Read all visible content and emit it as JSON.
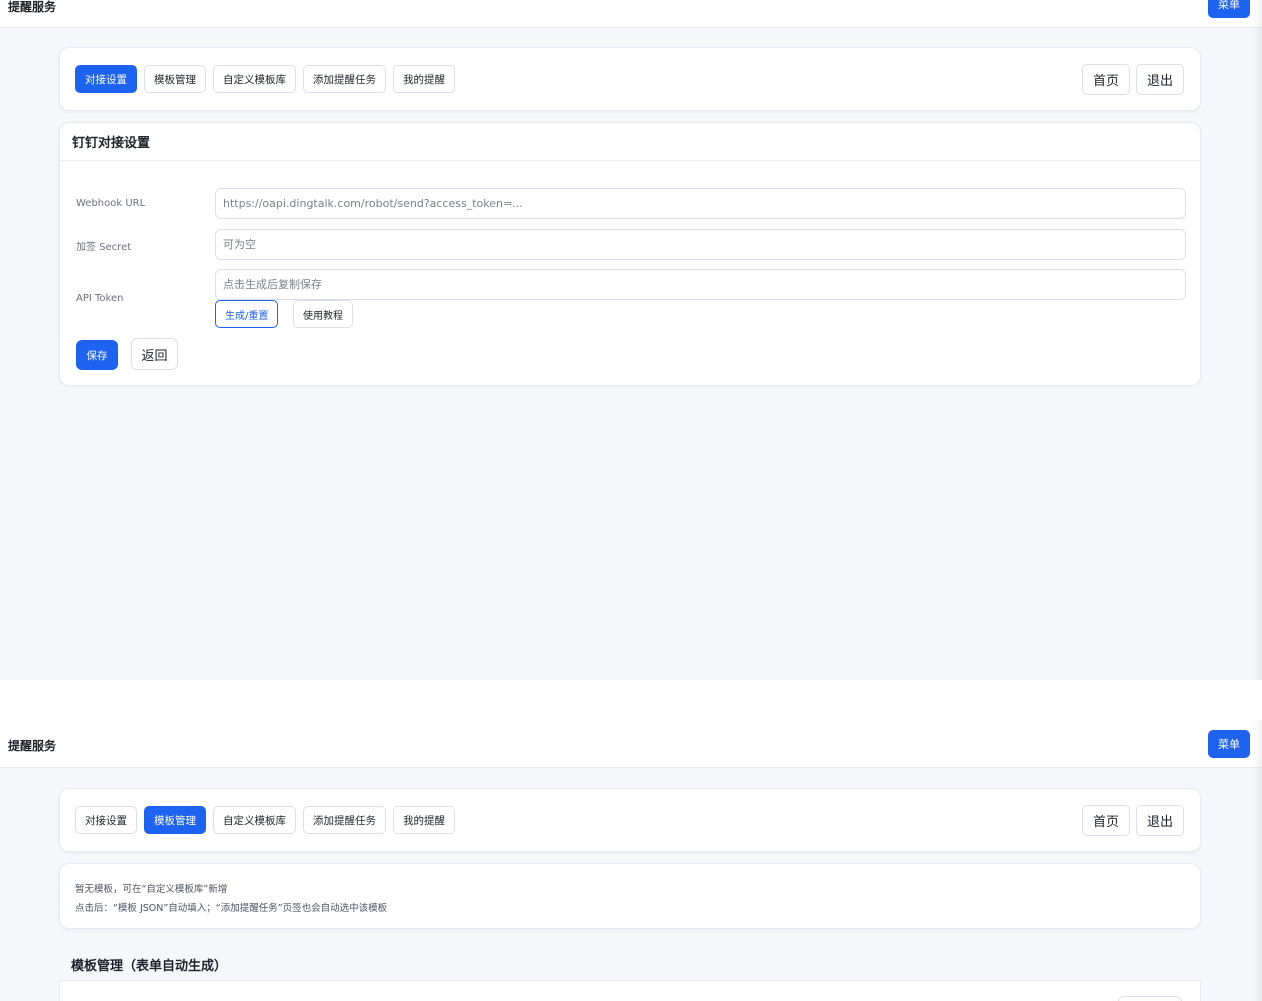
{
  "brand": "提醒服务",
  "menu_label": "菜单",
  "tabs": [
    "对接设置",
    "模板管理",
    "自定义模板库",
    "添加提醒任务",
    "我的提醒"
  ],
  "nav_right": {
    "home": "首页",
    "logout": "退出"
  },
  "dingtalk": {
    "title": "钉钉对接设置",
    "webhook_label": "Webhook URL",
    "webhook_placeholder": "https://oapi.dingtalk.com/robot/send?access_token=...",
    "secret_label": "加签 Secret",
    "secret_placeholder": "可为空",
    "token_label": "API Token",
    "token_placeholder": "点击生成后复制保存",
    "generate_label": "生成/重置",
    "tutorial_label": "使用教程",
    "save_label": "保存",
    "back_label": "返回"
  },
  "templates": {
    "hint_line1": "暂无模板，可在“自定义模板库”新增",
    "hint_line2": "点击后：“模板 JSON”自动填入；“添加提醒任务”页签也会自动选中该模板",
    "section_title": "模板管理（表单自动生成）"
  },
  "colors": {
    "primary": "#1d63f0",
    "background": "#f5f7fb",
    "border": "#dcdfe6"
  }
}
